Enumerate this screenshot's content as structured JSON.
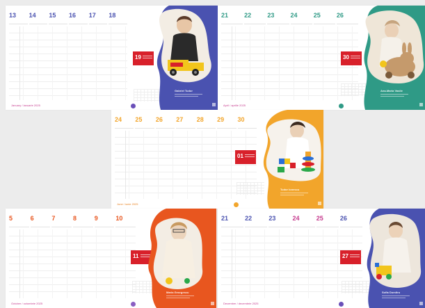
{
  "spreads": [
    {
      "id": "s1",
      "accent": "#4a52b0",
      "days": [
        "13",
        "14",
        "15",
        "16",
        "17",
        "18"
      ],
      "marker": "19",
      "marker_color": "#d8202a",
      "footer": "January / ianuarie 2025",
      "footer_color": "#c63b8e",
      "caption_title": "Gabriel Tudor",
      "photo_desc": "toddler with toy truck"
    },
    {
      "id": "s2",
      "accent": "#2f9a86",
      "days": [
        "21",
        "22",
        "23",
        "24",
        "25",
        "26"
      ],
      "marker": "30",
      "marker_color": "#d8202a",
      "footer": "April / aprilie 2025",
      "footer_color": "#c63b8e",
      "caption_title": "Ana-Maria Vasile",
      "photo_desc": "toddler with wooden bunny"
    },
    {
      "id": "s3",
      "accent": "#f2a52b",
      "days": [
        "24",
        "25",
        "26",
        "27",
        "28",
        "29",
        "30"
      ],
      "marker": "01",
      "marker_color": "#d8202a",
      "footer": "June / iunie 2025",
      "footer_color": "#e8801f",
      "caption_title": "Tudor Ionescu",
      "photo_desc": "child with stacking toys"
    },
    {
      "id": "s4",
      "accent": "#e8561f",
      "days": [
        "5",
        "6",
        "7",
        "8",
        "9",
        "10"
      ],
      "marker": "11",
      "marker_color": "#d8202a",
      "footer": "October / octombrie 2025",
      "footer_color": "#c63b8e",
      "caption_title": "Maria Georgescu",
      "photo_desc": "toddler in cream dress"
    },
    {
      "id": "s5",
      "accent": "#4a52b0",
      "days": [
        "21",
        "22",
        "23",
        "24",
        "25",
        "26"
      ],
      "marker": "27",
      "marker_color": "#d8202a",
      "footer": "December / decembrie 2025",
      "footer_color": "#c63b8e",
      "caption_title": "Sofia Dumitru",
      "photo_desc": "toddler with yellow toy"
    }
  ]
}
